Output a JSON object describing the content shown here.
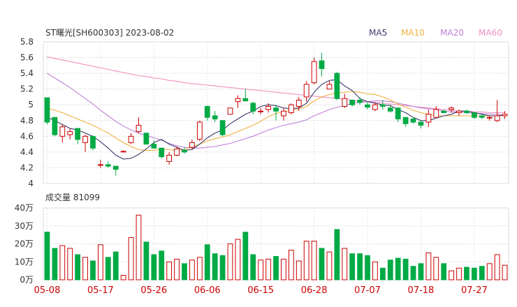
{
  "chart_data": [
    {
      "type": "candlestick",
      "title": "ST曙光[SH600303] 2023-08-02",
      "legend_placement": "top-right",
      "legend": [
        {
          "name": "MA5",
          "color": "#3a3a6a"
        },
        {
          "name": "MA10",
          "color": "#f0b040"
        },
        {
          "name": "MA20",
          "color": "#c080d8"
        },
        {
          "name": "MA60",
          "color": "#f090c0"
        }
      ],
      "ylim": [
        4,
        5.8
      ],
      "yticks": [
        "5.8",
        "5.6",
        "5.4",
        "5.2",
        "5",
        "4.8",
        "4.6",
        "4.4",
        "4.2",
        "4"
      ],
      "grid": true,
      "up_color": "#cc0000",
      "down_color": "#00aa44",
      "ohlc": [
        [
          5.09,
          5.09,
          4.75,
          4.78
        ],
        [
          4.84,
          4.84,
          4.6,
          4.62
        ],
        [
          4.6,
          4.75,
          4.52,
          4.72
        ],
        [
          4.62,
          4.7,
          4.56,
          4.66
        ],
        [
          4.7,
          4.7,
          4.5,
          4.56
        ],
        [
          4.52,
          4.62,
          4.4,
          4.6
        ],
        [
          4.6,
          4.6,
          4.42,
          4.45
        ],
        [
          4.24,
          4.3,
          4.2,
          4.24
        ],
        [
          4.24,
          4.28,
          4.2,
          4.22
        ],
        [
          4.22,
          4.22,
          4.1,
          4.18
        ],
        [
          4.4,
          4.42,
          4.4,
          4.41
        ],
        [
          4.52,
          4.64,
          4.5,
          4.6
        ],
        [
          4.66,
          4.84,
          4.64,
          4.74
        ],
        [
          4.64,
          4.64,
          4.5,
          4.5
        ],
        [
          4.5,
          4.55,
          4.44,
          4.45
        ],
        [
          4.45,
          4.45,
          4.32,
          4.34
        ],
        [
          4.28,
          4.4,
          4.24,
          4.36
        ],
        [
          4.36,
          4.47,
          4.35,
          4.44
        ],
        [
          4.42,
          4.46,
          4.38,
          4.4
        ],
        [
          4.46,
          4.56,
          4.44,
          4.52
        ],
        [
          4.56,
          4.8,
          4.54,
          4.78
        ],
        [
          4.98,
          4.99,
          4.8,
          4.84
        ],
        [
          4.86,
          4.92,
          4.78,
          4.82
        ],
        [
          4.8,
          4.8,
          4.6,
          4.62
        ],
        [
          4.88,
          4.96,
          4.88,
          4.96
        ],
        [
          5.04,
          5.12,
          4.96,
          5.08
        ],
        [
          5.08,
          5.2,
          5.04,
          5.05
        ],
        [
          5.02,
          5.04,
          4.88,
          4.92
        ],
        [
          4.92,
          4.96,
          4.88,
          4.92
        ],
        [
          4.94,
          5.02,
          4.9,
          4.98
        ],
        [
          4.96,
          5.0,
          4.8,
          4.92
        ],
        [
          4.86,
          4.96,
          4.8,
          4.92
        ],
        [
          4.9,
          5.02,
          4.88,
          5.0
        ],
        [
          4.98,
          5.1,
          4.92,
          5.06
        ],
        [
          5.1,
          5.3,
          5.04,
          5.26
        ],
        [
          5.28,
          5.6,
          5.26,
          5.55
        ],
        [
          5.56,
          5.66,
          5.36,
          5.46
        ],
        [
          5.2,
          5.3,
          5.2,
          5.26
        ],
        [
          5.4,
          5.42,
          5.06,
          5.08
        ],
        [
          4.98,
          5.14,
          4.96,
          5.08
        ],
        [
          5.06,
          5.06,
          4.98,
          5.0
        ],
        [
          5.06,
          5.1,
          5.0,
          5.03
        ],
        [
          5.0,
          5.04,
          4.94,
          4.97
        ],
        [
          4.94,
          5.03,
          4.92,
          5.0
        ],
        [
          5.0,
          5.06,
          4.94,
          4.98
        ],
        [
          4.96,
          5.0,
          4.9,
          4.92
        ],
        [
          4.96,
          4.96,
          4.78,
          4.82
        ],
        [
          4.84,
          4.84,
          4.72,
          4.76
        ],
        [
          4.82,
          4.84,
          4.76,
          4.78
        ],
        [
          4.78,
          4.8,
          4.7,
          4.74
        ],
        [
          4.78,
          4.94,
          4.72,
          4.88
        ],
        [
          4.84,
          4.98,
          4.84,
          4.94
        ],
        [
          4.92,
          4.94,
          4.9,
          4.9
        ],
        [
          4.94,
          4.98,
          4.9,
          4.96
        ],
        [
          4.9,
          4.94,
          4.86,
          4.92
        ],
        [
          4.92,
          4.94,
          4.88,
          4.9
        ],
        [
          4.9,
          4.9,
          4.82,
          4.84
        ],
        [
          4.86,
          4.88,
          4.82,
          4.84
        ],
        [
          4.84,
          4.86,
          4.8,
          4.84
        ],
        [
          4.8,
          5.06,
          4.78,
          4.86
        ],
        [
          4.86,
          4.92,
          4.82,
          4.88
        ]
      ],
      "ma5": [
        4.84,
        4.8,
        4.75,
        4.7,
        4.68,
        4.64,
        4.6,
        4.53,
        4.45,
        4.36,
        4.31,
        4.32,
        4.37,
        4.44,
        4.52,
        4.56,
        4.5,
        4.46,
        4.42,
        4.43,
        4.5,
        4.58,
        4.64,
        4.68,
        4.76,
        4.82,
        4.88,
        4.92,
        4.98,
        5.0,
        4.99,
        4.96,
        4.95,
        4.96,
        5.02,
        5.16,
        5.26,
        5.31,
        5.32,
        5.24,
        5.18,
        5.08,
        5.04,
        5.02,
        5.0,
        4.99,
        4.94,
        4.9,
        4.84,
        4.8,
        4.8,
        4.83,
        4.86,
        4.88,
        4.92,
        4.92,
        4.9,
        4.88,
        4.86,
        4.86,
        4.87
      ],
      "ma10": [
        4.96,
        4.93,
        4.9,
        4.86,
        4.82,
        4.78,
        4.74,
        4.69,
        4.64,
        4.58,
        4.52,
        4.47,
        4.43,
        4.42,
        4.42,
        4.44,
        4.43,
        4.42,
        4.43,
        4.46,
        4.5,
        4.54,
        4.57,
        4.59,
        4.62,
        4.66,
        4.7,
        4.74,
        4.79,
        4.85,
        4.89,
        4.91,
        4.93,
        4.95,
        4.98,
        5.05,
        5.1,
        5.13,
        5.15,
        5.16,
        5.17,
        5.16,
        5.14,
        5.13,
        5.1,
        5.06,
        5.01,
        4.97,
        4.93,
        4.9,
        4.88,
        4.86,
        4.86,
        4.86,
        4.86,
        4.86,
        4.86,
        4.86,
        4.86,
        4.86,
        4.87
      ],
      "ma20": [
        5.4,
        5.34,
        5.28,
        5.22,
        5.15,
        5.08,
        5.01,
        4.93,
        4.86,
        4.79,
        4.73,
        4.68,
        4.64,
        4.61,
        4.58,
        4.55,
        4.51,
        4.48,
        4.46,
        4.45,
        4.45,
        4.46,
        4.47,
        4.49,
        4.51,
        4.54,
        4.57,
        4.6,
        4.64,
        4.68,
        4.71,
        4.74,
        4.76,
        4.78,
        4.81,
        4.86,
        4.9,
        4.94,
        4.97,
        4.99,
        5.02,
        5.03,
        5.04,
        5.05,
        5.05,
        5.04,
        5.02,
        5.0,
        4.98,
        4.96,
        4.95,
        4.94,
        4.92,
        4.91,
        4.91,
        4.9,
        4.89,
        4.89,
        4.88,
        4.88,
        4.87
      ],
      "ma60": [
        5.61,
        5.59,
        5.57,
        5.55,
        5.53,
        5.51,
        5.49,
        5.47,
        5.45,
        5.43,
        5.41,
        5.39,
        5.37,
        5.36,
        5.34,
        5.33,
        5.31,
        5.3,
        5.28,
        5.27,
        5.26,
        5.25,
        5.24,
        5.23,
        5.22,
        5.21,
        5.2,
        5.19,
        5.18,
        5.17,
        5.16,
        5.15,
        5.14,
        5.13,
        5.12,
        5.11,
        5.1,
        5.09,
        5.08,
        5.07,
        5.06,
        5.05,
        5.04,
        5.03,
        5.02,
        5.01,
        5.0,
        4.99,
        4.98,
        4.97,
        4.96,
        4.95,
        4.94,
        4.93,
        4.92,
        4.92,
        4.91,
        4.91,
        4.9,
        4.9,
        4.9
      ]
    },
    {
      "type": "bar",
      "title": "成交量 81099",
      "ylim": [
        0,
        40
      ],
      "yticks": [
        "40万",
        "30万",
        "20万",
        "10万",
        "0万"
      ],
      "grid": true,
      "xticks": [
        {
          "label": "05-08",
          "index": 0
        },
        {
          "label": "05-17",
          "index": 7
        },
        {
          "label": "05-26",
          "index": 14
        },
        {
          "label": "06-06",
          "index": 21
        },
        {
          "label": "06-15",
          "index": 28
        },
        {
          "label": "06-28",
          "index": 35
        },
        {
          "label": "07-07",
          "index": 42
        },
        {
          "label": "07-18",
          "index": 49
        },
        {
          "label": "07-27",
          "index": 56
        }
      ],
      "values": [
        26.5,
        17.5,
        19,
        17.5,
        14,
        12.5,
        10.5,
        19.5,
        12.5,
        15.5,
        2.5,
        23.5,
        36,
        21,
        14,
        16,
        10,
        11.5,
        9,
        11,
        12.5,
        19.5,
        14.5,
        13.5,
        20,
        22.5,
        26.5,
        14,
        11,
        11.5,
        13,
        11.5,
        16.5,
        10.5,
        21.5,
        21.5,
        17.5,
        15.5,
        28,
        17.5,
        14.5,
        14.5,
        13.5,
        10,
        6.5,
        11,
        12,
        11.5,
        7.5,
        9,
        15,
        12.5,
        9,
        5,
        6.5,
        7,
        6.5,
        7.5,
        9,
        14,
        8.1
      ]
    }
  ]
}
